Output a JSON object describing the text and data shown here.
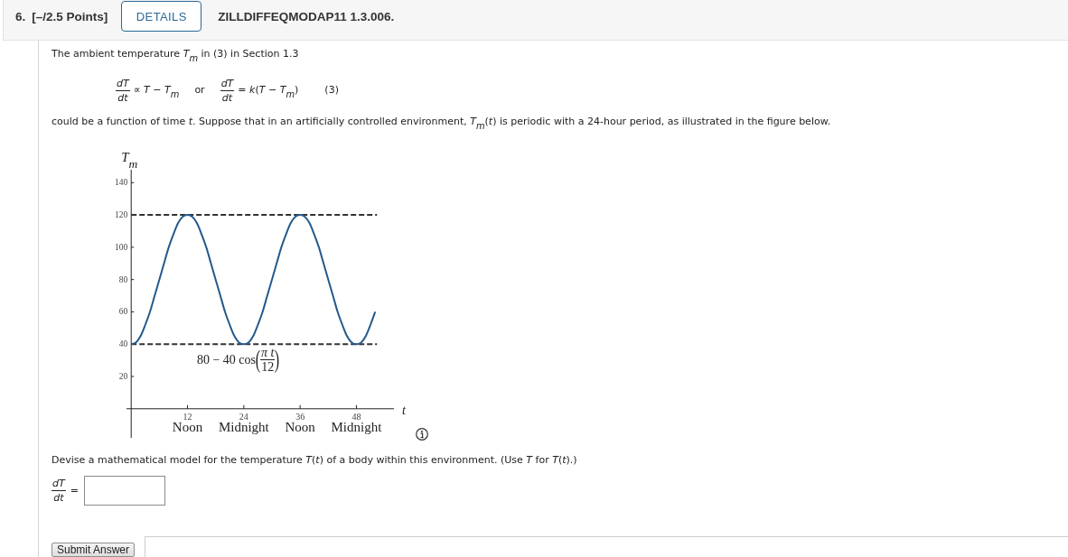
{
  "header": {
    "number": "6.",
    "points": "[–/2.5 Points]",
    "details_button": "DETAILS",
    "code": "ZILLDIFFEQMODAP11 1.3.006."
  },
  "intro": "The ambient temperature *T*$_{m}$ in (3) in Section 1.3",
  "equations": [
    {
      "numerator": "dT",
      "denominator": "dt",
      "rhs": "∝ *T* − *T*$_{m}$"
    },
    {
      "numerator": "dT",
      "denominator": "dt",
      "rhs": "= *k*(*T* − *T*$_{m}$)"
    }
  ],
  "equation_connector": "or",
  "equation_number": "(3)",
  "description": "could be a function of time *t*. Suppose that in an artificially controlled environment, *T*$_{m}$(*t*) is periodic with a 24-hour period, as illustrated in the figure below.",
  "figure": {
    "chart_data": {
      "type": "line",
      "xlabel": "t",
      "ylabel": "T$_{m}$",
      "x": [
        0,
        1,
        2,
        3,
        4,
        5,
        6,
        7,
        8,
        9,
        10,
        11,
        12,
        13,
        14,
        15,
        16,
        17,
        18,
        19,
        20,
        21,
        22,
        23,
        24,
        25,
        26,
        27,
        28,
        29,
        30,
        31,
        32,
        33,
        34,
        35,
        36,
        37,
        38,
        39,
        40,
        41,
        42,
        43,
        44,
        45,
        46,
        47,
        48,
        49,
        50,
        51,
        52
      ],
      "series": [
        {
          "color": "#235a8c",
          "values": [
            40,
            41,
            45,
            52,
            60,
            70,
            80,
            90,
            100,
            108,
            115,
            119,
            120,
            119,
            115,
            108,
            100,
            90,
            80,
            70,
            60,
            52,
            45,
            41,
            40,
            41,
            45,
            52,
            60,
            70,
            80,
            90,
            100,
            108,
            115,
            119,
            120,
            119,
            115,
            108,
            100,
            90,
            80,
            70,
            60,
            52,
            45,
            41,
            40,
            41,
            45,
            52,
            60
          ]
        }
      ],
      "xlim": [
        -1,
        56
      ],
      "ylim": [
        -18,
        148
      ],
      "xticks": [
        {
          "value": 12,
          "label": "12\nNoon"
        },
        {
          "value": 24,
          "label": "24\nMidnight"
        },
        {
          "value": 36,
          "label": "36\nNoon"
        },
        {
          "value": 48,
          "label": "48\nMidnight"
        }
      ],
      "yticks": [
        20,
        40,
        60,
        80,
        100,
        120,
        140
      ],
      "ref_lines": [
        {
          "axis": "y",
          "value": 120
        },
        {
          "axis": "y",
          "value": 40
        }
      ]
    },
    "curve_label": {
      "text": "80 − 40 cos",
      "open": "(",
      "numerator": "π t",
      "denominator": "12",
      "close": ")"
    }
  },
  "task": "Devise a mathematical model for the temperature *T*(*t*) of a body within this environment. (Use *T* for *T*(*t*).)",
  "answer": {
    "numerator": "dT",
    "denominator": "dt",
    "operator": "="
  },
  "submit_button": "Submit Answer"
}
